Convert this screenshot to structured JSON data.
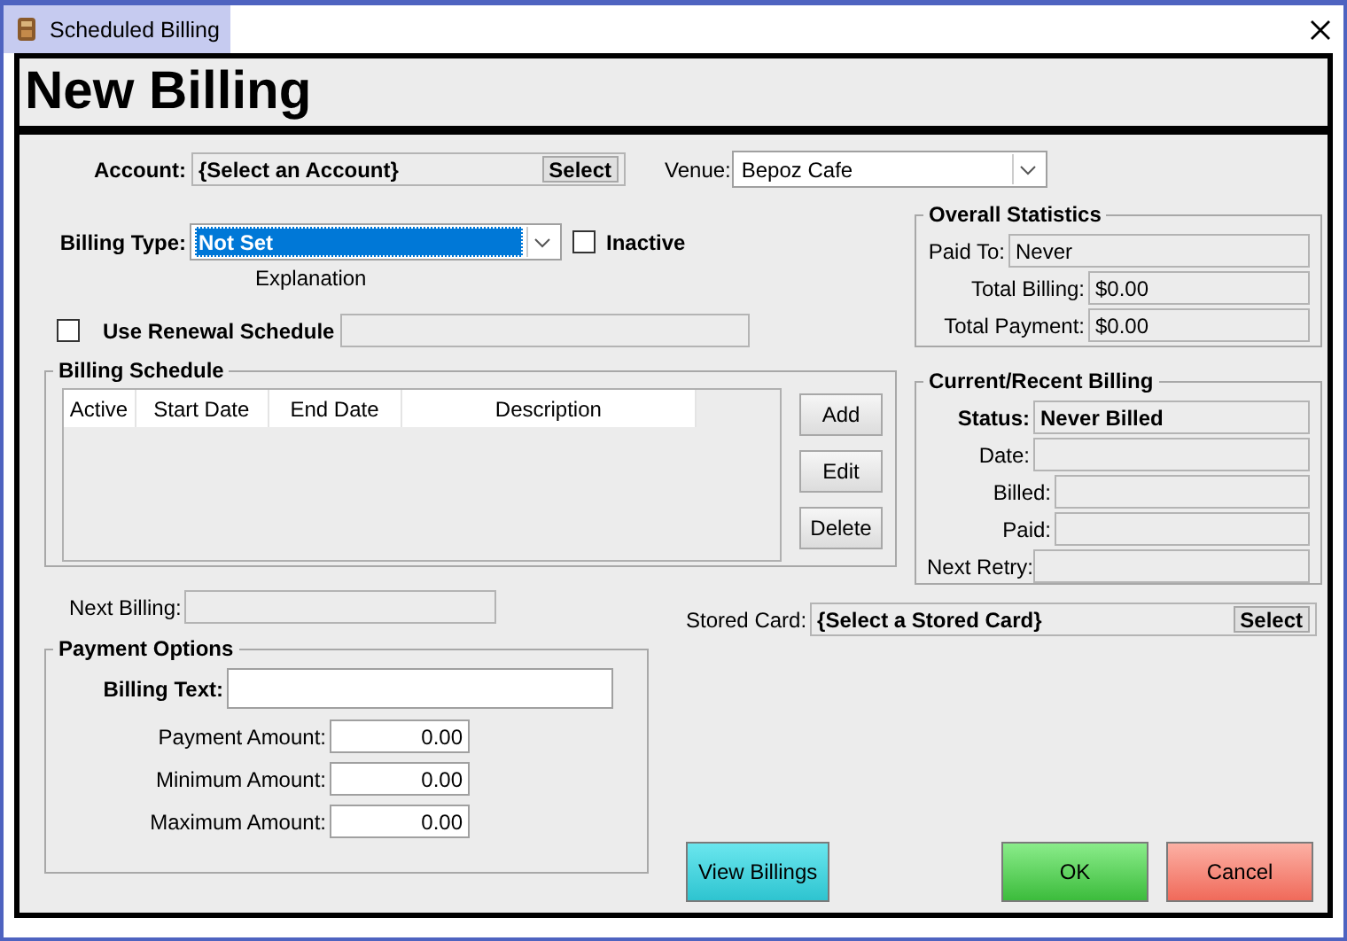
{
  "window": {
    "title": "Scheduled Billing"
  },
  "header": {
    "title": "New Billing"
  },
  "account": {
    "label": "Account:",
    "value": "{Select an Account}",
    "button": "Select"
  },
  "venue": {
    "label": "Venue:",
    "value": "Bepoz Cafe"
  },
  "billing_type": {
    "label": "Billing Type:",
    "value": "Not Set",
    "highlighted": true
  },
  "inactive": {
    "label": "Inactive",
    "checked": false
  },
  "explanation": "Explanation",
  "renewal": {
    "label": "Use Renewal Schedule",
    "checked": false
  },
  "billing_schedule": {
    "title": "Billing Schedule",
    "columns": [
      "Active",
      "Start Date",
      "End Date",
      "Description"
    ],
    "buttons": [
      "Add",
      "Edit",
      "Delete"
    ]
  },
  "next_billing": {
    "label": "Next Billing:"
  },
  "overall_statistics": {
    "title": "Overall Statistics",
    "fields": [
      {
        "label": "Paid To:",
        "value": "Never"
      },
      {
        "label": "Total Billing:",
        "value": "$0.00"
      },
      {
        "label": "Total Payment:",
        "value": "$0.00"
      }
    ]
  },
  "current_billing": {
    "title": "Current/Recent Billing",
    "fields": [
      {
        "label": "Status:",
        "value": "Never Billed",
        "kind": "emphasis"
      },
      {
        "label": "Date:",
        "kind": "plain"
      },
      {
        "label": "Billed:",
        "kind": "plain"
      },
      {
        "label": "Paid:",
        "kind": "plain"
      },
      {
        "label": "Next Retry:",
        "kind": "plain"
      }
    ]
  },
  "stored_card": {
    "label": "Stored Card:",
    "value": "{Select a Stored Card}",
    "button": "Select"
  },
  "payment_options": {
    "title": "Payment Options",
    "billing_text": {
      "label": "Billing Text:"
    },
    "amounts": [
      {
        "label": "Payment Amount:",
        "value": "0.00"
      },
      {
        "label": "Minimum Amount:",
        "value": "0.00"
      },
      {
        "label": "Maximum Amount:",
        "value": "0.00"
      }
    ]
  },
  "buttons": [
    {
      "label": "View Billings",
      "kind": "info"
    },
    {
      "label": "OK",
      "kind": "confirm"
    },
    {
      "label": "Cancel",
      "kind": "cancel"
    }
  ]
}
